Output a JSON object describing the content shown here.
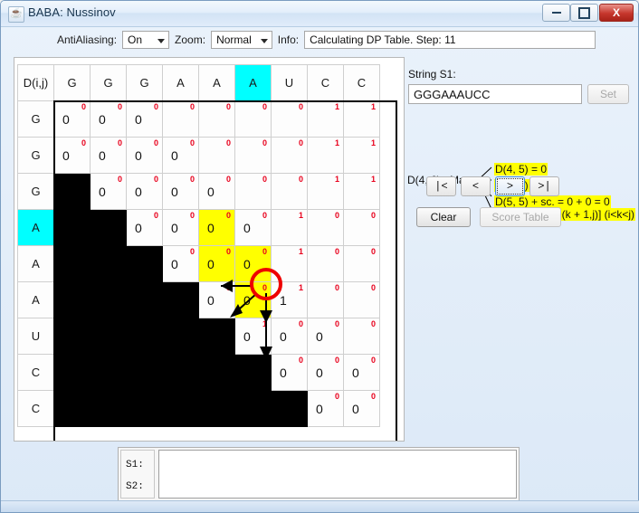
{
  "window": {
    "title": "BABA: Nussinov",
    "app_icon": "java-icon",
    "buttons": {
      "minimize": "minimize-icon",
      "maximize": "maximize-icon",
      "close": "X"
    }
  },
  "toolbar": {
    "antialiasing_label": "AntiAliasing:",
    "antialiasing_value": "On",
    "zoom_label": "Zoom:",
    "zoom_value": "Normal",
    "info_label": "Info:",
    "info_value": "Calculating DP Table. Step: 11"
  },
  "table": {
    "corner_label": "D(i,j)",
    "columns": [
      "G",
      "G",
      "G",
      "A",
      "A",
      "A",
      "U",
      "C",
      "C"
    ],
    "rows": [
      "G",
      "G",
      "G",
      "A",
      "A",
      "A",
      "U",
      "C",
      "C"
    ],
    "selected_col_index": 5,
    "selected_row_index": 3,
    "cells": [
      [
        {
          "v": "0",
          "r": "0"
        },
        {
          "v": "0",
          "r": "0"
        },
        {
          "v": "0",
          "r": "0"
        },
        {
          "v": "",
          "r": "0"
        },
        {
          "v": "",
          "r": "0"
        },
        {
          "v": "",
          "r": "0"
        },
        {
          "v": "",
          "r": "0"
        },
        {
          "v": "",
          "r": "1"
        },
        {
          "v": "",
          "r": "1"
        }
      ],
      [
        {
          "v": "0",
          "r": "0"
        },
        {
          "v": "0",
          "r": "0"
        },
        {
          "v": "0",
          "r": "0"
        },
        {
          "v": "0",
          "r": "0"
        },
        {
          "v": "",
          "r": "0"
        },
        {
          "v": "",
          "r": "0"
        },
        {
          "v": "",
          "r": "0"
        },
        {
          "v": "",
          "r": "1"
        },
        {
          "v": "",
          "r": "1"
        }
      ],
      [
        {
          "v": "",
          "r": "",
          "black": true
        },
        {
          "v": "0",
          "r": "0"
        },
        {
          "v": "0",
          "r": "0"
        },
        {
          "v": "0",
          "r": "0"
        },
        {
          "v": "0",
          "r": "0"
        },
        {
          "v": "",
          "r": "0"
        },
        {
          "v": "",
          "r": "0"
        },
        {
          "v": "",
          "r": "1"
        },
        {
          "v": "",
          "r": "1"
        }
      ],
      [
        {
          "v": "",
          "r": "",
          "black": true
        },
        {
          "v": "",
          "r": "",
          "black": true
        },
        {
          "v": "0",
          "r": "0"
        },
        {
          "v": "0",
          "r": "0"
        },
        {
          "v": "0",
          "r": "0",
          "hl": true
        },
        {
          "v": "0",
          "r": "0",
          "circ": true
        },
        {
          "v": "",
          "r": "1"
        },
        {
          "v": "",
          "r": "0"
        },
        {
          "v": "",
          "r": "0"
        }
      ],
      [
        {
          "v": "",
          "r": "",
          "black": true
        },
        {
          "v": "",
          "r": "",
          "black": true
        },
        {
          "v": "",
          "r": "",
          "black": true
        },
        {
          "v": "0",
          "r": "0"
        },
        {
          "v": "0",
          "r": "0",
          "hl": true
        },
        {
          "v": "0",
          "r": "0",
          "hl": true
        },
        {
          "v": "",
          "r": "1"
        },
        {
          "v": "",
          "r": "0"
        },
        {
          "v": "",
          "r": "0"
        }
      ],
      [
        {
          "v": "",
          "r": "",
          "black": true
        },
        {
          "v": "",
          "r": "",
          "black": true
        },
        {
          "v": "",
          "r": "",
          "black": true
        },
        {
          "v": "",
          "r": "",
          "black": true
        },
        {
          "v": "0",
          "r": "0"
        },
        {
          "v": "0",
          "r": "0",
          "hl": true
        },
        {
          "v": "1",
          "r": "1"
        },
        {
          "v": "",
          "r": "0"
        },
        {
          "v": "",
          "r": "0"
        }
      ],
      [
        {
          "v": "",
          "r": "",
          "black": true
        },
        {
          "v": "",
          "r": "",
          "black": true
        },
        {
          "v": "",
          "r": "",
          "black": true
        },
        {
          "v": "",
          "r": "",
          "black": true
        },
        {
          "v": "",
          "r": "",
          "black": true
        },
        {
          "v": "0",
          "r": "1"
        },
        {
          "v": "0",
          "r": "0"
        },
        {
          "v": "0",
          "r": "0"
        },
        {
          "v": "",
          "r": "0"
        }
      ],
      [
        {
          "v": "",
          "r": "",
          "black": true
        },
        {
          "v": "",
          "r": "",
          "black": true
        },
        {
          "v": "",
          "r": "",
          "black": true
        },
        {
          "v": "",
          "r": "",
          "black": true
        },
        {
          "v": "",
          "r": "",
          "black": true
        },
        {
          "v": "",
          "r": "",
          "black": true
        },
        {
          "v": "0",
          "r": "0"
        },
        {
          "v": "0",
          "r": "0"
        },
        {
          "v": "0",
          "r": "0"
        }
      ],
      [
        {
          "v": "",
          "r": "",
          "black": true
        },
        {
          "v": "",
          "r": "",
          "black": true
        },
        {
          "v": "",
          "r": "",
          "black": true
        },
        {
          "v": "",
          "r": "",
          "black": true
        },
        {
          "v": "",
          "r": "",
          "black": true
        },
        {
          "v": "",
          "r": "",
          "black": true
        },
        {
          "v": "",
          "r": "",
          "black": true
        },
        {
          "v": "0",
          "r": "0"
        },
        {
          "v": "0",
          "r": "0"
        }
      ]
    ]
  },
  "right": {
    "s1_label": "String S1:",
    "s1_value": "GGGAAAUCC",
    "set_label": "Set",
    "formula_lhs": "D(4, 6)= Max",
    "formula_lines": [
      "D(4, 5) = 0",
      "D(5, 6) = 0",
      "D(5, 5) + sc. = 0 + 0 = 0",
      "Max[D(i,k)+ D(k + 1,j)] (i<k<j)"
    ],
    "nav_first": "|<",
    "nav_prev": "<",
    "nav_next": ">",
    "nav_last": ">|",
    "clear_label": "Clear",
    "score_table_label": "Score Table"
  },
  "bottom": {
    "s1_label": "S1:",
    "s2_label": "S2:",
    "s1_value": "",
    "s2_value": ""
  },
  "colors": {
    "highlight": "#ffff00",
    "selected": "#00ffff",
    "red_value": "#e8001c",
    "circle": "#ee0000",
    "blocked": "#000000"
  }
}
